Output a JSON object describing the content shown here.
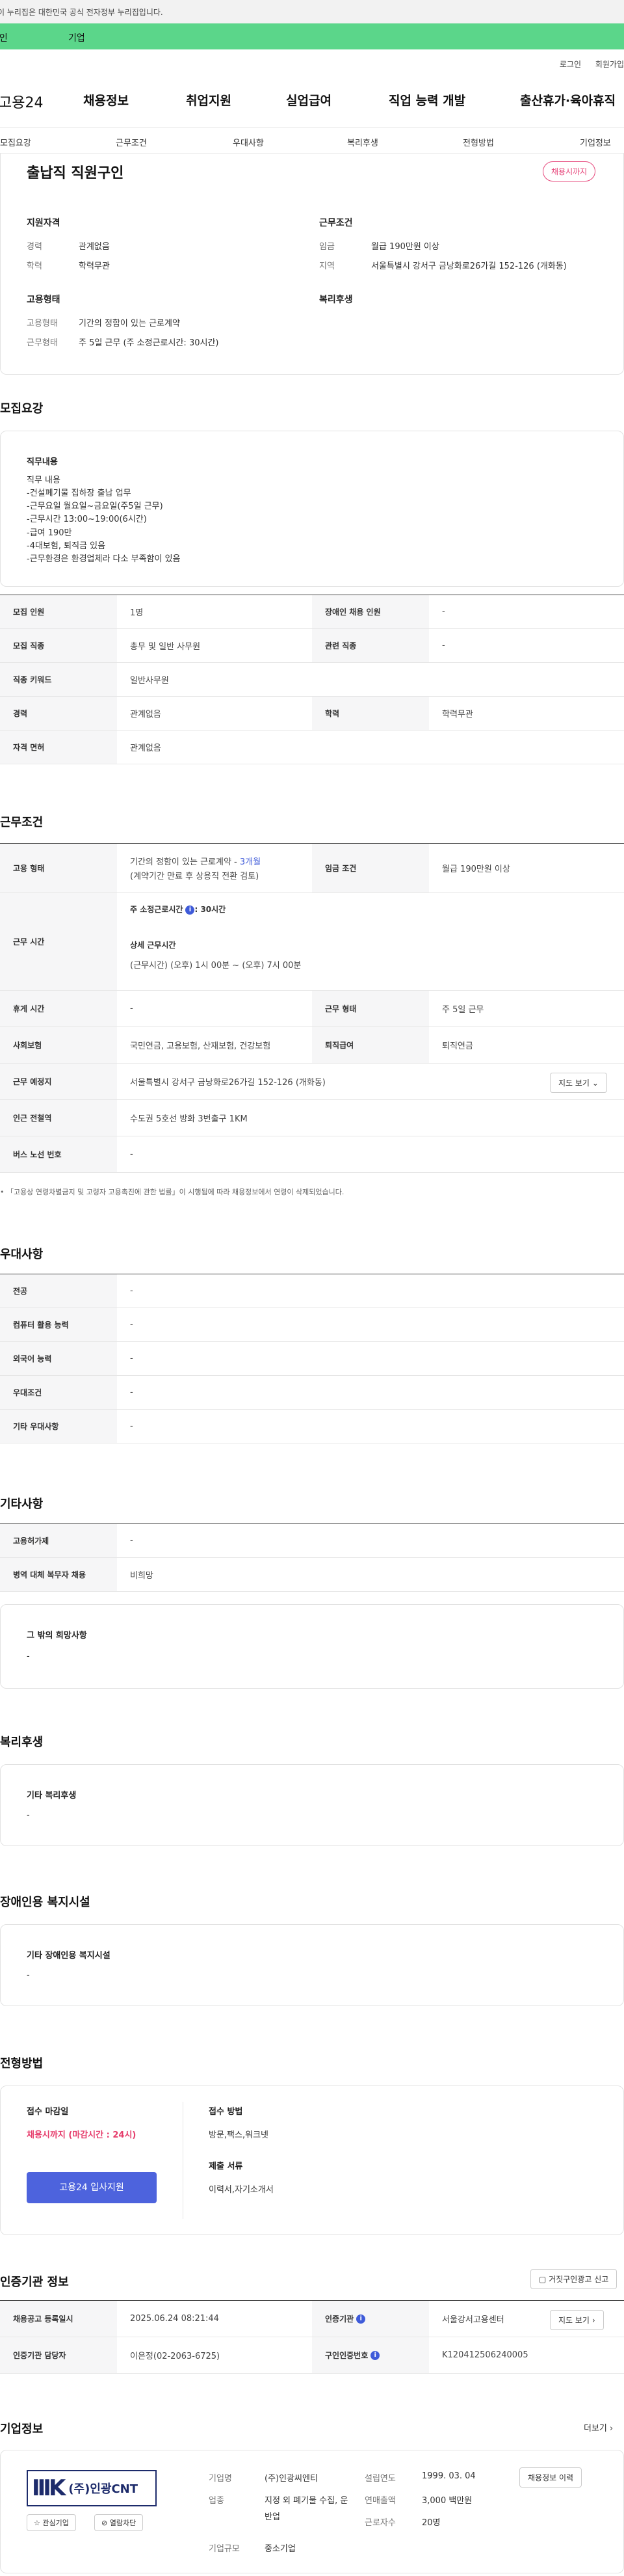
{
  "gov_banner": "이 누리집은 대한민국 공식 전자정부 누리집입니다.",
  "tabs": [
    "개인",
    "기업"
  ],
  "top_links": [
    "로그인",
    "회원가입"
  ],
  "gnb": {
    "logo": "고용24",
    "menu": [
      "채용정보",
      "취업지원",
      "실업급여",
      "직업 능력 개발",
      "출산휴가·육아휴직"
    ]
  },
  "subnav": [
    "모집요강",
    "근무조건",
    "우대사항",
    "복리후생",
    "전형방법",
    "기업정보"
  ],
  "summary": {
    "title": "출납직 직원구인",
    "badge": "채용시까지",
    "qual_h": "지원자격",
    "career_k": "경력",
    "career_v": "관계없음",
    "edu_k": "학력",
    "edu_v": "학력무관",
    "work_h": "근무조건",
    "wage_k": "임금",
    "wage_v": "월급 190만원 이상",
    "region_k": "지역",
    "region_v": "서울특별시 강서구 금낭화로26가길 152-126 (개화동)",
    "emp_h": "고용형태",
    "emp_k1": "고용형태",
    "emp_v1": "기간의 정함이 있는 근로계약",
    "emp_k2": "근무형태",
    "emp_v2": "주 5일 근무 (주 소정근로시간: 30시간)",
    "welfare_h": "복리후생"
  },
  "recruit": {
    "heading": "모집요강",
    "duty_h": "직무내용",
    "duty_text": "직무 내용\n-건설폐기물 집하장 출납 업무\n-근무요일 월요일~금요일(주5일 근무)\n-근무시간 13:00~19:00(6시간)\n-급여 190만\n-4대보험, 퇴직금 있음\n-근무환경은 환경업체라 다소 부족함이 있음",
    "rows": [
      {
        "k": "모집 인원",
        "v": "1명",
        "k2": "장애인 채용 인원",
        "v2": "-"
      },
      {
        "k": "모집 직종",
        "v": "총무 및 일반 사무원",
        "k2": "관련 직종",
        "v2": "-"
      },
      {
        "k": "직종 키워드",
        "v": "일반사무원"
      },
      {
        "k": "경력",
        "v": "관계없음",
        "k2": "학력",
        "v2": "학력무관"
      },
      {
        "k": "자격 면허",
        "v": "관계없음"
      }
    ]
  },
  "conditions": {
    "heading": "근무조건",
    "emp_k": "고용 형태",
    "emp_v1": "기간의 정함이 있는 근로계약 - ",
    "emp_v1b": "3개월",
    "emp_v2": "(계약기간 만료 후 상용직 전환 검토)",
    "wage_k": "임금 조건",
    "wage_v": "월급 190만원 이상",
    "time_k": "근무 시간",
    "time_l1a": "주 소정근로시간",
    "time_l1b": ": 30시간",
    "time_l2": "상세 근무시간",
    "time_l3": "(근무시간) (오후) 1시 00분 ~ (오후) 7시 00분",
    "rows": [
      {
        "k": "휴게 시간",
        "v": "-",
        "k2": "근무 형태",
        "v2": "주 5일 근무"
      },
      {
        "k": "사회보험",
        "v": "국민연금, 고용보험, 산재보험, 건강보험",
        "k2": "퇴직급여",
        "v2": "퇴직연금"
      }
    ],
    "place_k": "근무 예정지",
    "place_v": "서울특별시 강서구 금낭화로26가길 152-126 (개화동)",
    "map_btn": "지도 보기",
    "station_k": "인근 전철역",
    "station_v": "수도권 5호선 방화 3번출구 1KM",
    "bus_k": "버스 노선 번호",
    "bus_v": "-",
    "notice": "「고용상 연령차별금지 및 고령자 고용촉진에 관한 법률」이 시행됨에 따라 채용정보에서 연령이 삭제되었습니다."
  },
  "preference": {
    "heading": "우대사항",
    "rows": [
      {
        "k": "전공",
        "v": "-"
      },
      {
        "k": "컴퓨터 활용 능력",
        "v": "-"
      },
      {
        "k": "외국어 능력",
        "v": "-"
      },
      {
        "k": "우대조건",
        "v": "-"
      },
      {
        "k": "기타 우대사항",
        "v": "-"
      }
    ]
  },
  "other": {
    "heading": "기타사항",
    "rows": [
      {
        "k": "고용허가제",
        "v": "-"
      },
      {
        "k": "병역 대체 복무자 채용",
        "v": "비희망"
      }
    ],
    "box_h": "그 밖의 희망사항",
    "box_v": "-"
  },
  "welfare": {
    "heading": "복리후생",
    "box_h": "기타 복리후생",
    "box_v": "-"
  },
  "disability": {
    "heading": "장애인용 복지시설",
    "box_h": "기타 장애인용 복지시설",
    "box_v": "-"
  },
  "selection": {
    "heading": "전형방법",
    "deadline_h": "접수 마감일",
    "deadline_v": "채용시까지 (마감시간 : 24시)",
    "apply_btn": "고용24 입사지원",
    "method_h": "접수 방법",
    "method_v": "방문,팩스,워크넷",
    "docs_h": "제출 서류",
    "docs_v": "이력서,자기소개서"
  },
  "agency": {
    "heading": "인증기관 정보",
    "report_btn": "거짓구인광고 신고",
    "reg_k": "채용공고 등록일시",
    "reg_v": "2025.06.24 08:21:44",
    "org_k": "인증기관",
    "org_v": "서울강서고용센터",
    "map_btn": "지도 보기",
    "staff_k": "인증기관 담당자",
    "staff_v": "이은정(02-2063-6725)",
    "no_k": "구인인증번호",
    "no_v": "K120412506240005"
  },
  "company": {
    "heading": "기업정보",
    "more": "더보기",
    "logo_text": "(주)인광CNT",
    "interest_btn": "관심기업",
    "block_btn": "열람차단",
    "name_k": "기업명",
    "name_v": "(주)인광씨엔티",
    "industry_k": "업종",
    "industry_v": "지정 외 폐기물 수집, 운반업",
    "size_k": "기업규모",
    "size_v": "중소기업",
    "est_k": "설립연도",
    "est_v": "1999. 03. 04",
    "sales_k": "연매출액",
    "sales_v": "3,000 백만원",
    "emp_k": "근로자수",
    "emp_v": "20명",
    "history_btn": "채용정보 이력"
  }
}
